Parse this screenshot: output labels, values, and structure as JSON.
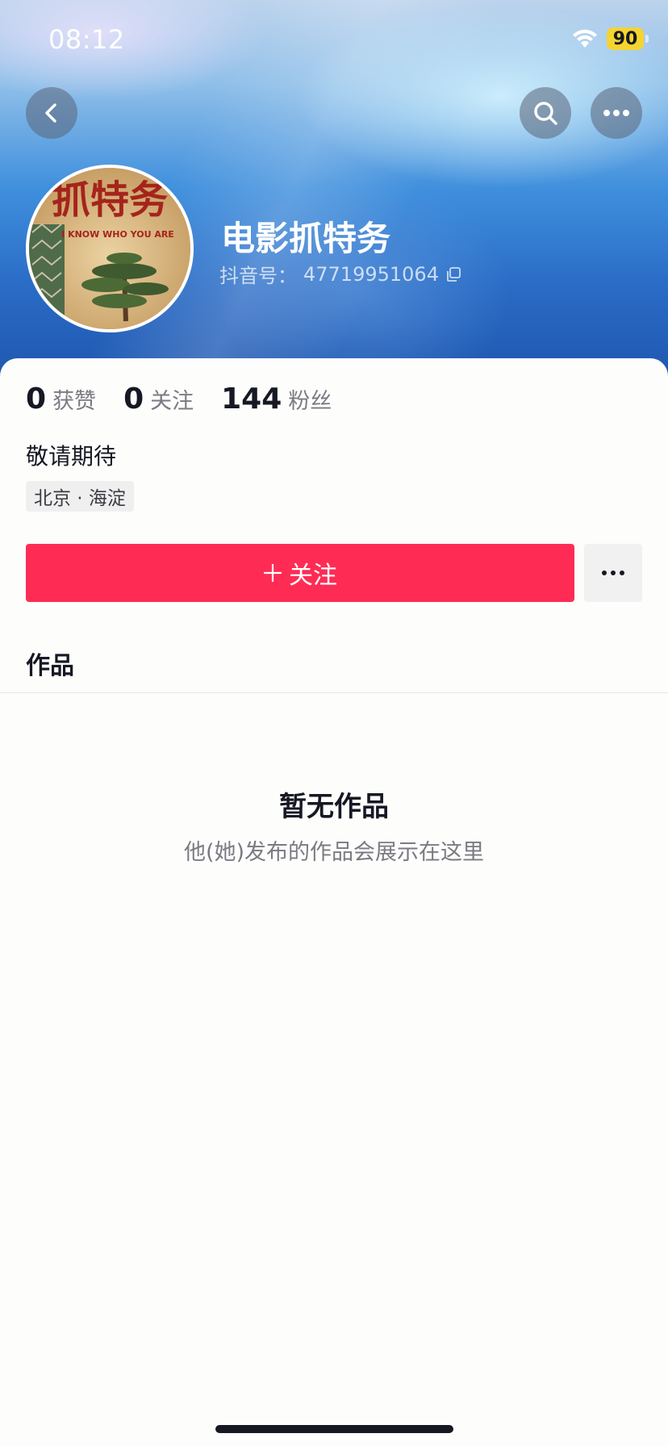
{
  "status_bar": {
    "time": "08:12",
    "battery": "90"
  },
  "profile": {
    "nickname": "电影抓特务",
    "douyin_id_label": "抖音号：",
    "douyin_id": "47719951064",
    "avatar_title": "抓特务",
    "avatar_subtitle": "I KNOW WHO YOU ARE"
  },
  "stats": [
    {
      "value": "0",
      "label": "获赞"
    },
    {
      "value": "0",
      "label": "关注"
    },
    {
      "value": "144",
      "label": "粉丝"
    }
  ],
  "bio": "敬请期待",
  "location": "北京 · 海淀",
  "actions": {
    "follow_label": "关注",
    "follow_icon": "plus-icon",
    "more_icon": "ellipsis-icon"
  },
  "tabs": {
    "works": "作品"
  },
  "empty_state": {
    "title": "暂无作品",
    "subtitle": "他(她)发布的作品会展示在这里"
  },
  "colors": {
    "accent": "#fe2c55",
    "battery": "#f5d431",
    "header_blue": "#2a6cc6"
  },
  "icons": {
    "back": "chevron-left-icon",
    "search": "search-icon",
    "more": "more-dots-icon",
    "copy": "copy-icon"
  }
}
